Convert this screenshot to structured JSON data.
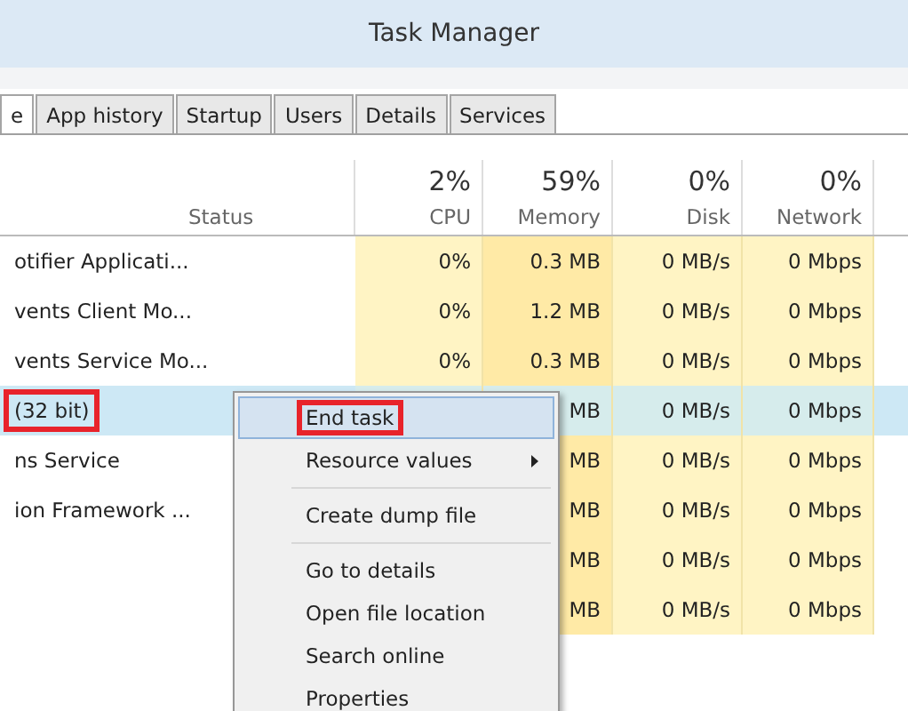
{
  "window": {
    "title": "Task Manager"
  },
  "tabs": [
    {
      "label": "e",
      "selected": true
    },
    {
      "label": "App history",
      "selected": false
    },
    {
      "label": "Startup",
      "selected": false
    },
    {
      "label": "Users",
      "selected": false
    },
    {
      "label": "Details",
      "selected": false
    },
    {
      "label": "Services",
      "selected": false
    }
  ],
  "table": {
    "columns": [
      {},
      {
        "label": "Status"
      },
      {
        "label": "CPU",
        "total": "2%"
      },
      {
        "label": "Memory",
        "total": "59%"
      },
      {
        "label": "Disk",
        "total": "0%"
      },
      {
        "label": "Network",
        "total": "0%"
      }
    ],
    "rows": [
      {
        "name": "otifier Applicati...",
        "cpu": "0%",
        "memory": "0.3 MB",
        "disk": "0 MB/s",
        "network": "0 Mbps",
        "selected": false,
        "marked": false
      },
      {
        "name": "vents Client Mo...",
        "cpu": "0%",
        "memory": "1.2 MB",
        "disk": "0 MB/s",
        "network": "0 Mbps",
        "selected": false,
        "marked": false
      },
      {
        "name": "vents Service Mo...",
        "cpu": "0%",
        "memory": "0.3 MB",
        "disk": "0 MB/s",
        "network": "0 Mbps",
        "selected": false,
        "marked": false
      },
      {
        "name": "(32 bit)",
        "memory": "MB",
        "disk": "0 MB/s",
        "network": "0 Mbps",
        "selected": true,
        "marked": true
      },
      {
        "name": "ns Service",
        "memory": "MB",
        "disk": "0 MB/s",
        "network": "0 Mbps",
        "selected": false,
        "marked": false
      },
      {
        "name": "ion Framework ...",
        "memory": "MB",
        "disk": "0 MB/s",
        "network": "0 Mbps",
        "selected": false,
        "marked": false
      },
      {
        "memory": "MB",
        "disk": "0 MB/s",
        "network": "0 Mbps",
        "selected": false,
        "marked": false
      },
      {
        "memory": "MB",
        "disk": "0 MB/s",
        "network": "0 Mbps",
        "selected": false,
        "marked": false
      }
    ]
  },
  "context_menu": {
    "items": [
      {
        "kind": "item",
        "label": "End task",
        "selected": true,
        "marked": true,
        "submenu": false
      },
      {
        "kind": "item",
        "label": "Resource values",
        "selected": false,
        "marked": false,
        "submenu": true
      },
      {
        "kind": "separator"
      },
      {
        "kind": "item",
        "label": "Create dump file",
        "selected": false,
        "marked": false,
        "submenu": false
      },
      {
        "kind": "separator"
      },
      {
        "kind": "item",
        "label": "Go to details",
        "selected": false,
        "marked": false,
        "submenu": false
      },
      {
        "kind": "item",
        "label": "Open file location",
        "selected": false,
        "marked": false,
        "submenu": false
      },
      {
        "kind": "item",
        "label": "Search online",
        "selected": false,
        "marked": false,
        "submenu": false
      },
      {
        "kind": "item",
        "label": "Properties",
        "selected": false,
        "marked": false,
        "submenu": false
      }
    ]
  }
}
